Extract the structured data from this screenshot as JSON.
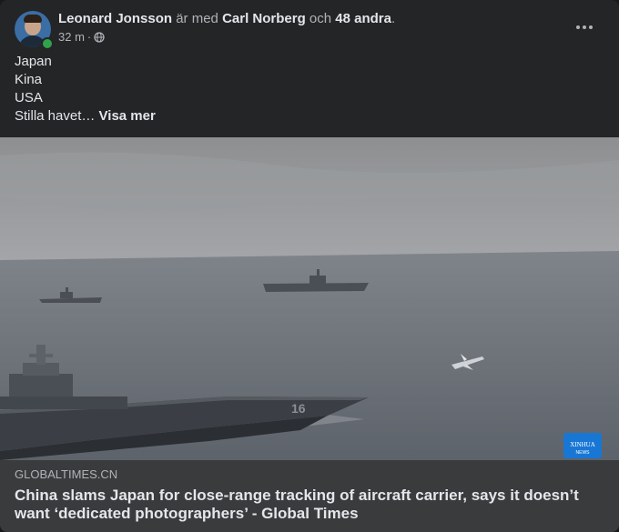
{
  "post": {
    "author": "Leonard Jonsson",
    "with_text": "är med",
    "tagged": "Carl Norberg",
    "and_text": "och",
    "others": "48 andra",
    "period": ".",
    "time": "32 m",
    "separator": "·",
    "privacy_icon": "globe-icon",
    "more_icon": "more-options-icon",
    "lines": [
      "Japan",
      "Kina",
      "USA"
    ],
    "last_line": "Stilla havet…",
    "see_more": "Visa mer"
  },
  "link": {
    "image_alt_scene": "aircraft carrier photo",
    "watermark": "XINHUA NEWS",
    "hull_number": "16",
    "domain": "GLOBALTIMES.CN",
    "title": "China slams Japan for close-range tracking of aircraft carrier, says it doesn’t want ‘dedicated photographers’ - Global Times"
  },
  "colors": {
    "card_bg": "#242526",
    "link_bg": "#3a3b3c",
    "text_primary": "#e4e6eb",
    "text_secondary": "#b0b3b8",
    "online": "#31a24c",
    "watermark_bg": "#1877d4"
  }
}
